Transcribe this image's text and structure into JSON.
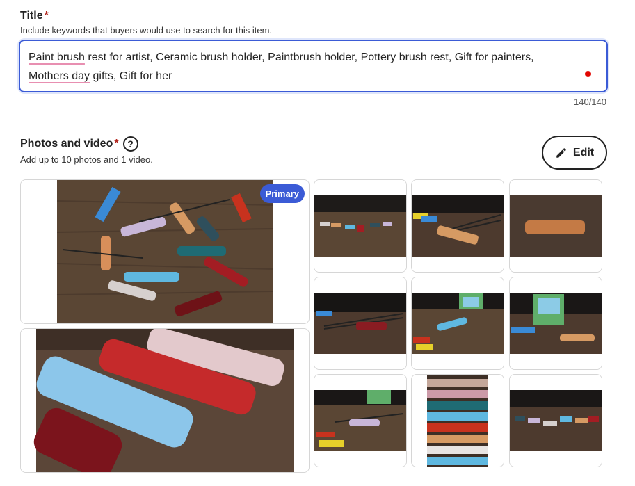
{
  "title_field": {
    "label": "Title",
    "required_mark": "*",
    "hint": "Include keywords that buyers would use to search for this item.",
    "value_part1_spell": "Paint brush",
    "value_part2": " rest for artist, Ceramic brush holder, Paintbrush holder, Pottery brush rest, Gift for painters,",
    "value_part3_spell": "Mothers day",
    "value_part4": " gifts, Gift for her",
    "char_count": "140/140"
  },
  "photos_section": {
    "label": "Photos and video",
    "required_mark": "*",
    "help_icon": "question-circle-icon",
    "hint": "Add up to 10 photos and 1 video.",
    "edit_label": "Edit",
    "edit_icon": "pencil-icon",
    "primary_badge": "Primary",
    "photo_count": 11
  },
  "colors": {
    "accent": "#3b5bd6",
    "required": "#b3261e",
    "error_dot": "#e10600"
  }
}
